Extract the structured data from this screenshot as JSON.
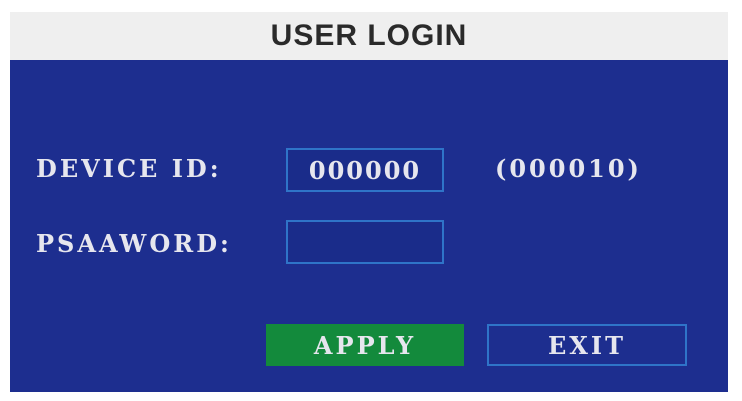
{
  "window": {
    "title": "USER LOGIN"
  },
  "form": {
    "device_id_label": "DEVICE ID:",
    "device_id_value": "000000",
    "device_id_hint": "(000010)",
    "password_label": "PSAAWORD:",
    "password_value": ""
  },
  "buttons": {
    "apply_label": "APPLY",
    "exit_label": "EXIT"
  },
  "colors": {
    "panel_background": "#1d2e8f",
    "title_background": "#efefef",
    "apply_button": "#138a3c",
    "field_border": "#2f74c8",
    "text": "#e6e6ee"
  }
}
